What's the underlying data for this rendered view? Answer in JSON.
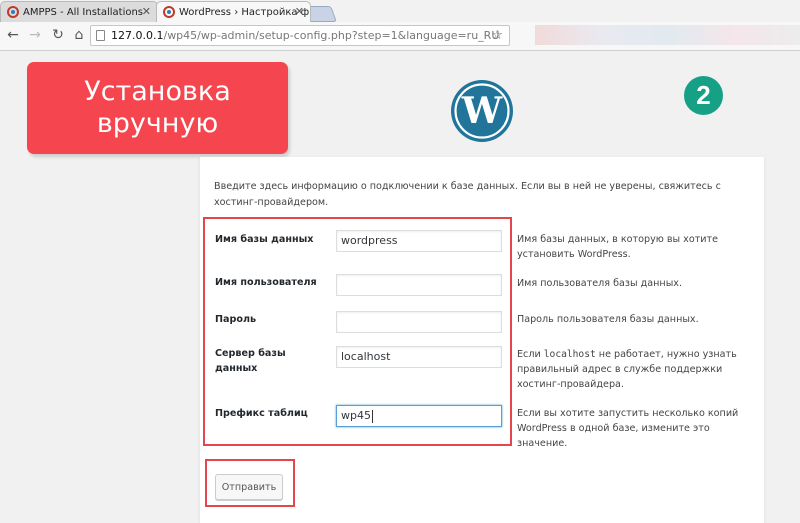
{
  "browser": {
    "tabs": [
      {
        "title": "AMPPS - All Installations",
        "active": false
      },
      {
        "title": "WordPress › Настройка ф",
        "active": true
      }
    ],
    "url": {
      "host": "127.0.0.1",
      "path": "/wp45/wp-admin/setup-config.php?step=1&language=ru_RU"
    }
  },
  "annotations": {
    "callout": "Установка вручную",
    "step": "2",
    "highlight_color": "#e7454d"
  },
  "form": {
    "intro": "Введите здесь информацию о подключении к базе данных. Если вы в ней не уверены, свяжитесь с хостинг-провайдером.",
    "fields": [
      {
        "label": "Имя базы данных",
        "value": "wordpress",
        "help": "Имя базы данных, в которую вы хотите установить WordPress."
      },
      {
        "label": "Имя пользователя",
        "value": "",
        "help": "Имя пользователя базы данных."
      },
      {
        "label": "Пароль",
        "value": "",
        "help": "Пароль пользователя базы данных."
      },
      {
        "label": "Сервер базы данных",
        "value": "localhost",
        "help_prefix": "Если ",
        "help_code": "localhost",
        "help_suffix": " не работает, нужно узнать правильный адрес в службе поддержки хостинг-провайдера."
      },
      {
        "label": "Префикс таблиц",
        "value": "wp45",
        "help": "Если вы хотите запустить несколько копий WordPress в одной базе, измените это значение."
      }
    ],
    "submit": "Отправить"
  },
  "colors": {
    "callout_bg": "#f5464f",
    "step_bg": "#16a085",
    "wp_blue": "#21759b"
  }
}
